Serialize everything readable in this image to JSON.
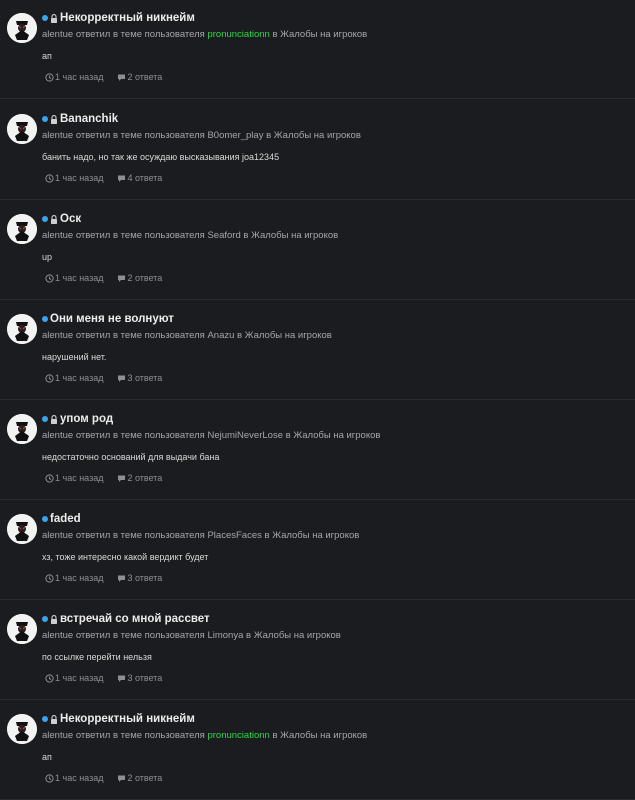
{
  "activity": [
    {
      "title": "Некорректный никнейм",
      "locked": true,
      "author": "alentue",
      "action": "ответил в теме пользователя",
      "thread_user": "pronunciationn",
      "thread_user_highlight": true,
      "in_word": "в",
      "forum": "Жалобы на игроков",
      "snippet": "ап",
      "time": "1 час назад",
      "replies": "2 ответа"
    },
    {
      "title": "Bananchik",
      "locked": true,
      "author": "alentue",
      "action": "ответил в теме пользователя",
      "thread_user": "B0omer_play",
      "thread_user_highlight": false,
      "in_word": "в",
      "forum": "Жалобы на игроков",
      "snippet": "банить надо, но так же осуждаю высказывания joa12345",
      "time": "1 час назад",
      "replies": "4 ответа"
    },
    {
      "title": "Оск",
      "locked": true,
      "author": "alentue",
      "action": "ответил в теме пользователя",
      "thread_user": "Seaford",
      "thread_user_highlight": false,
      "in_word": "в",
      "forum": "Жалобы на игроков",
      "snippet": "up",
      "time": "1 час назад",
      "replies": "2 ответа"
    },
    {
      "title": "Они меня не волнуют",
      "locked": false,
      "author": "alentue",
      "action": "ответил в теме пользователя",
      "thread_user": "Anazu",
      "thread_user_highlight": false,
      "in_word": "в",
      "forum": "Жалобы на игроков",
      "snippet": "нарушений нет.",
      "time": "1 час назад",
      "replies": "3 ответа"
    },
    {
      "title": "упом род",
      "locked": true,
      "author": "alentue",
      "action": "ответил в теме пользователя",
      "thread_user": "NejumiNeverLose",
      "thread_user_highlight": false,
      "in_word": "в",
      "forum": "Жалобы на игроков",
      "snippet": "недостаточно оснований для выдачи бана",
      "time": "1 час назад",
      "replies": "2 ответа"
    },
    {
      "title": "faded",
      "locked": false,
      "author": "alentue",
      "action": "ответил в теме пользователя",
      "thread_user": "PlacesFaces",
      "thread_user_highlight": false,
      "in_word": "в",
      "forum": "Жалобы на игроков",
      "snippet": "хз, тоже интересно какой вердикт будет",
      "time": "1 час назад",
      "replies": "3 ответа"
    },
    {
      "title": "встречай со мной рассвет",
      "locked": true,
      "author": "alentue",
      "action": "ответил в теме пользователя",
      "thread_user": "Limonya",
      "thread_user_highlight": false,
      "in_word": "в",
      "forum": "Жалобы на игроков",
      "snippet": "по ссылке перейти нельзя",
      "time": "1 час назад",
      "replies": "3 ответа"
    },
    {
      "title": "Некорректный никнейм",
      "locked": true,
      "author": "alentue",
      "action": "ответил в теме пользователя",
      "thread_user": "pronunciationn",
      "thread_user_highlight": true,
      "in_word": "в",
      "forum": "Жалобы на игроков",
      "snippet": "ап",
      "time": "1 час назад",
      "replies": "2 ответа"
    }
  ],
  "icons": {
    "unread": "unread-dot-icon",
    "lock": "lock-icon",
    "time": "clock-icon",
    "replies": "comment-icon"
  },
  "colors": {
    "background": "#1b1c1f",
    "unread_dot": "#3aa4f0",
    "highlight_user": "#32d74b"
  }
}
